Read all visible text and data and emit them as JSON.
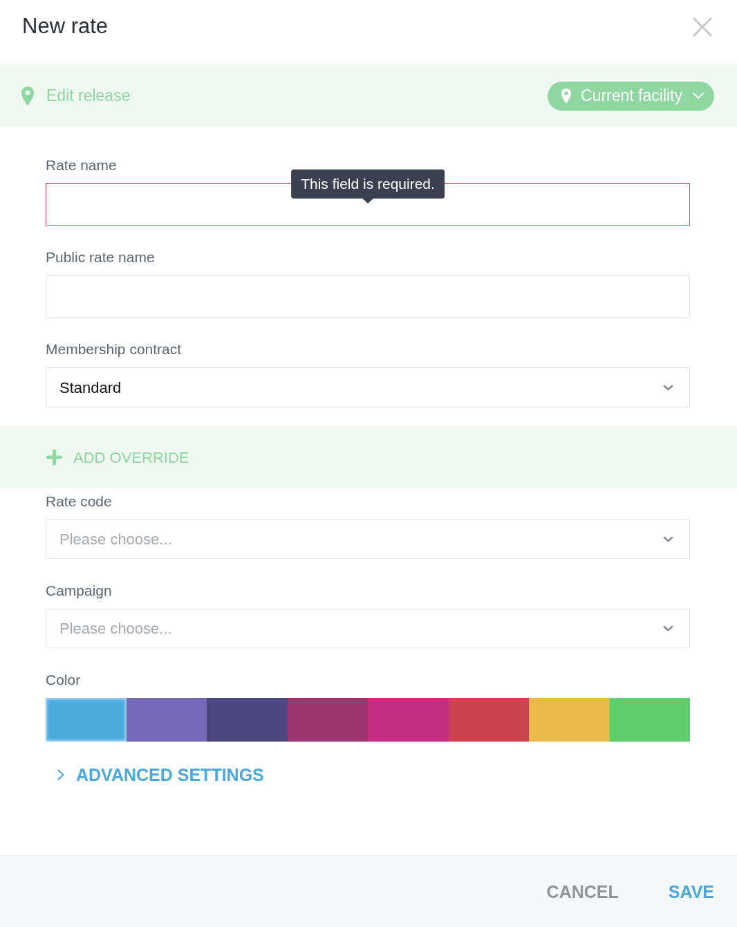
{
  "dialog": {
    "title": "New rate"
  },
  "location_bar": {
    "label": "Edit release",
    "facility_button": "Current facility"
  },
  "fields": [
    {
      "kind": "text",
      "label": "Rate name",
      "invalid": true,
      "error": "This field is required."
    },
    {
      "kind": "text",
      "label": "Public rate name",
      "invalid": false
    },
    {
      "kind": "select",
      "label": "Membership contract",
      "value": "Standard",
      "invalid": false
    }
  ],
  "add_override": {
    "label": "ADD OVERRIDE"
  },
  "override_fields": [
    {
      "kind": "select",
      "label": "Rate code",
      "placeholder": "Please choose...",
      "invalid": false
    },
    {
      "kind": "select",
      "label": "Campaign",
      "placeholder": "Please choose...",
      "invalid": false
    }
  ],
  "color_picker": {
    "label": "Color",
    "swatches": [
      {
        "color": "#4aabdf",
        "selected": true
      },
      {
        "color": "#7669b9",
        "selected": false
      },
      {
        "color": "#4f4781",
        "selected": false
      },
      {
        "color": "#9c3470",
        "selected": false
      },
      {
        "color": "#c52d80",
        "selected": false
      },
      {
        "color": "#cc4350",
        "selected": false
      },
      {
        "color": "#e8b84a",
        "selected": false
      },
      {
        "color": "#5ecd6c",
        "selected": false
      }
    ]
  },
  "advanced_settings": {
    "label": "ADVANCED SETTINGS",
    "expanded": false
  },
  "footer": {
    "buttons": [
      {
        "label": "CANCEL",
        "kind": "secondary"
      },
      {
        "label": "SAVE",
        "kind": "primary"
      }
    ]
  }
}
